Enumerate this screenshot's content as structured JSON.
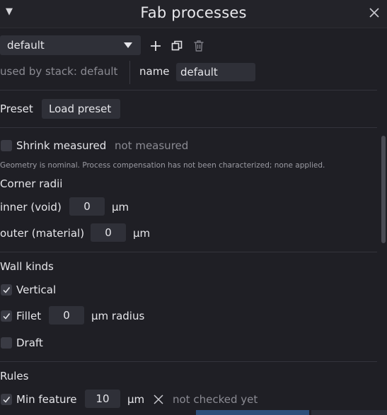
{
  "window": {
    "title": "Fab processes"
  },
  "process_selector": {
    "selected": "default"
  },
  "used_by": "used by stack: default",
  "name_field": {
    "label": "name",
    "value": "default"
  },
  "preset": {
    "label": "Preset",
    "button": "Load preset"
  },
  "shrink": {
    "label": "Shrink measured",
    "status": "not measured",
    "checked": false
  },
  "note": "Geometry is nominal. Process compensation has not been characterized; none applied.",
  "corner_radii": {
    "heading": "Corner radii",
    "inner_label": "inner (void)",
    "inner_value": "0",
    "inner_unit": "µm",
    "outer_label": "outer (material)",
    "outer_value": "0",
    "outer_unit": "µm"
  },
  "wall_kinds": {
    "heading": "Wall kinds",
    "vertical": {
      "label": "Vertical",
      "checked": true
    },
    "fillet": {
      "label": "Fillet",
      "checked": true,
      "value": "0",
      "unit": "µm radius"
    },
    "draft": {
      "label": "Draft",
      "checked": false
    }
  },
  "rules": {
    "heading": "Rules",
    "min_feature": {
      "label": "Min feature",
      "checked": true,
      "value": "10",
      "unit": "µm",
      "status": "not checked yet"
    }
  },
  "scrollbar": {
    "position_fraction": 0.0,
    "visible_fraction": 0.39
  }
}
